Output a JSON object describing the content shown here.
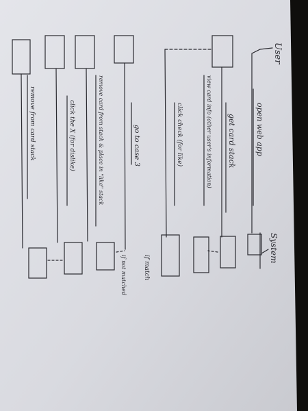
{
  "actors": {
    "user": "User",
    "system": "System"
  },
  "messages": [
    "open web app",
    "get card stack",
    "view card info (other user's information)",
    "click check (for like)",
    "if match",
    "go to case 3",
    "if not matched",
    "remove card from stack & place in \"like\" stack",
    "click the X (for dislike)",
    "remove from card stack"
  ],
  "colors": {
    "ink": "#2a2a30",
    "paper": "#dcdde3",
    "background": "#0f0e0c"
  }
}
